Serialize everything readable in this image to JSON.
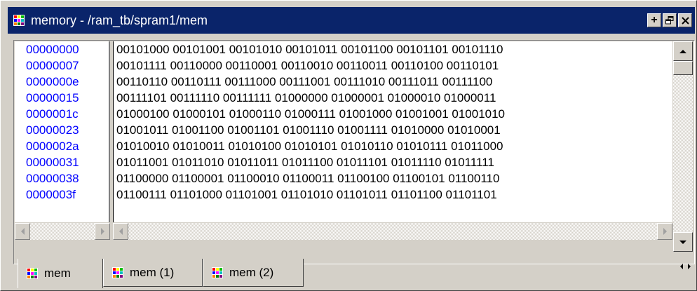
{
  "window": {
    "title": "memory - /ram_tb/spram1/mem",
    "colors": {
      "titlebar": "#0a246a",
      "address_text": "#0000ff"
    }
  },
  "title_buttons": [
    {
      "name": "plus-icon",
      "glyph": "+"
    },
    {
      "name": "undock-icon",
      "glyph": "⧉"
    },
    {
      "name": "close-icon",
      "glyph": "✕"
    }
  ],
  "memory": {
    "addresses": [
      "00000000",
      "00000007",
      "0000000e",
      "00000015",
      "0000001c",
      "00000023",
      "0000002a",
      "00000031",
      "00000038",
      "0000003f"
    ],
    "rows": [
      "00101000 00101001 00101010 00101011 00101100 00101101 00101110",
      "00101111 00110000 00110001 00110010 00110011 00110100 00110101",
      "00110110 00110111 00111000 00111001 00111010 00111011 00111100",
      "00111101 00111110 00111111 01000000 01000001 01000010 01000011",
      "01000100 01000101 01000110 01000111 01001000 01001001 01001010",
      "01001011 01001100 01001101 01001110 01001111 01010000 01010001",
      "01010010 01010011 01010100 01010101 01010110 01010111 01011000",
      "01011001 01011010 01011011 01011100 01011101 01011110 01011111",
      "01100000 01100001 01100010 01100011 01100100 01100101 01100110",
      "01100111 01101000 01101001 01101010 01101011 01101100 01101101"
    ]
  },
  "tabs": [
    {
      "label": "mem",
      "active": true
    },
    {
      "label": "mem (1)",
      "active": false
    },
    {
      "label": "mem (2)",
      "active": false
    }
  ]
}
